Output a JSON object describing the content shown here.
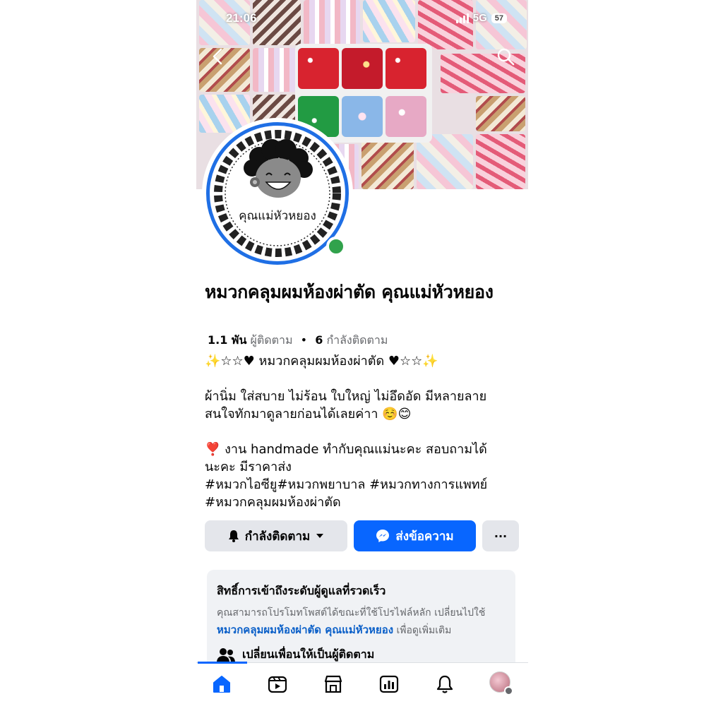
{
  "status_bar": {
    "time": "21:06",
    "network": "5G",
    "battery": "57"
  },
  "page": {
    "name": "หมวกคลุมผมห้องผ่าตัด คุณแม่หัวหยอง",
    "avatar_text": "คุณแม่หัวหยอง",
    "followers_count": "1.1 พัน",
    "followers_label": "ผู้ติดตาม",
    "separator": "•",
    "following_count": "6",
    "following_label": "กำลังติดตาม"
  },
  "bio": {
    "line1": "✨☆☆♥ หมวกคลุมผมห้องผ่าตัด ♥☆☆✨",
    "line2": "ผ้านิ่ม ใส่สบาย ไม่ร้อน ใบใหญ่ ไม่อึดอัด มีหลายลาย",
    "line3": "สนใจทักมาดูลายก่อนได้เลยค่าา ☺️😊",
    "line4": "❣️ งาน handmade ทำกับคุณแม่นะคะ สอบถามได้",
    "line5": "นะคะ มีราคาส่ง",
    "line6": "#หมวกไอซียู#หมวกพยาบาล #หมวกทางการแพทย์",
    "line7": "#หมวกคลุมผมห้องผ่าตัด"
  },
  "actions": {
    "following_label": "กำลังติดตาม",
    "message_label": "ส่งข้อความ",
    "more_label": "···"
  },
  "card": {
    "title": "สิทธิ์การเข้าถึงระดับผู้ดูแลที่รวดเร็ว",
    "text1": "คุณสามารถโปรโมทโพสต์ได้ขณะที่ใช้โปรไฟล์หลัก เปลี่ยนไปใช้",
    "link": "หมวกคลุมผมห้องผ่าตัด คุณแม่หัวหยอง",
    "text2": " เพื่อดูเพิ่มเติม",
    "row_label": "เปลี่ยนเพื่อนให้เป็นผู้ติดตาม"
  },
  "tabs": [
    "home-icon",
    "video-icon",
    "marketplace-icon",
    "dashboard-icon",
    "notifications-icon",
    "profile-icon"
  ],
  "colors": {
    "accent": "#0866ff",
    "online": "#31a24c",
    "ring": "#1f6fe5",
    "link": "#0a5fc8"
  }
}
